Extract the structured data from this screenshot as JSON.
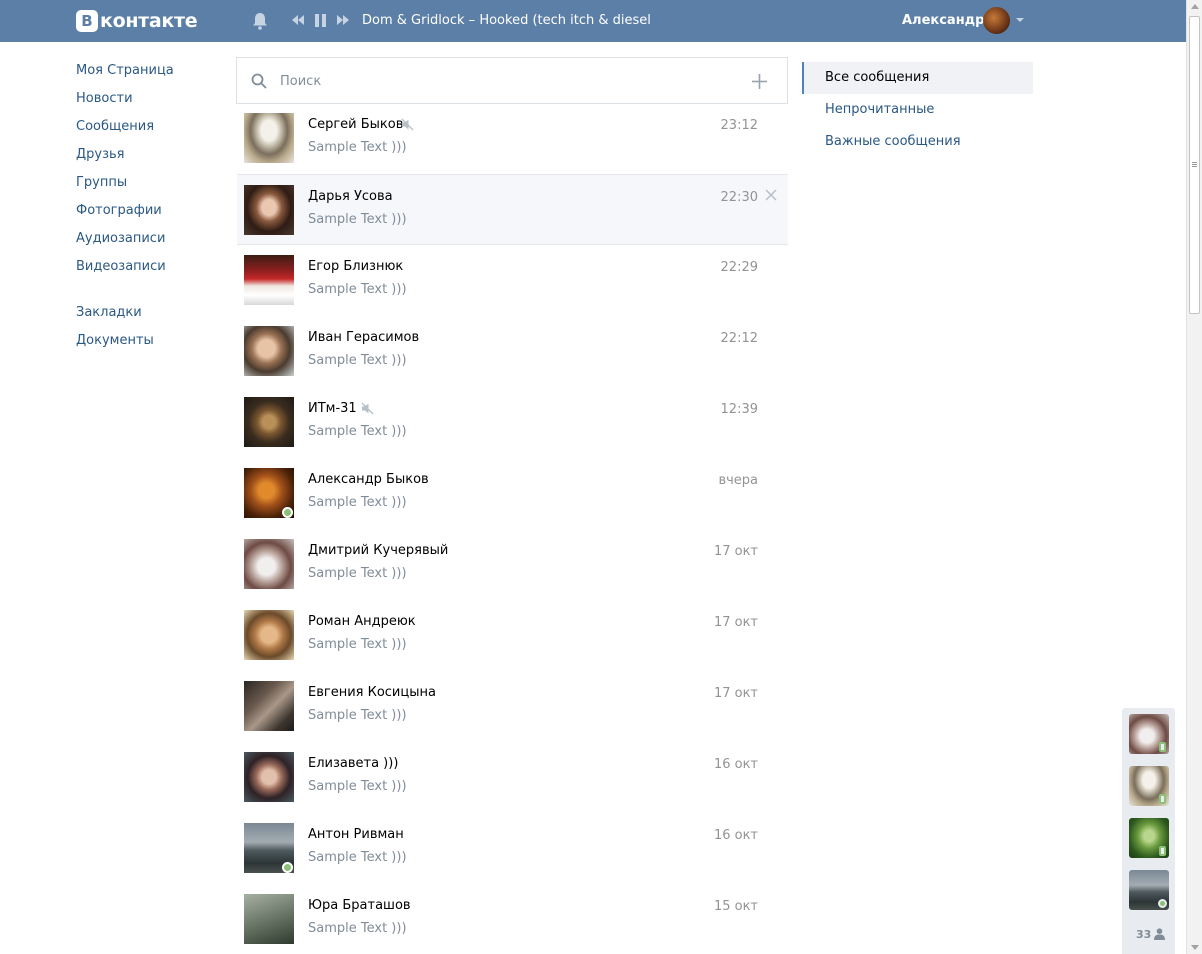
{
  "header": {
    "logo_letter": "В",
    "logo_text": "контакте",
    "track": "Dom & Gridlock – Hooked (tech itch & dieselbo...",
    "user_name": "Александр",
    "bg_color": "#5b7fa6"
  },
  "left_nav": {
    "items": [
      {
        "label": "Моя Страница"
      },
      {
        "label": "Новости"
      },
      {
        "label": "Сообщения"
      },
      {
        "label": "Друзья"
      },
      {
        "label": "Группы"
      },
      {
        "label": "Фотографии"
      },
      {
        "label": "Аудиозаписи"
      },
      {
        "label": "Видеозаписи"
      }
    ],
    "extra_items": [
      {
        "label": "Закладки"
      },
      {
        "label": "Документы"
      }
    ]
  },
  "search": {
    "placeholder": "Поиск"
  },
  "dialogs": [
    {
      "name": "Сергей Быков",
      "text": "Sample Text )))",
      "time": "23:12",
      "muted": true,
      "online": false,
      "avatar": "cosplay"
    },
    {
      "name": "Дарья Усова",
      "text": "Sample Text )))",
      "time": "22:30",
      "muted": false,
      "online": false,
      "avatar": "girl-dark",
      "hover": true
    },
    {
      "name": "Егор Близнюк",
      "text": "Sample Text )))",
      "time": "22:29",
      "muted": false,
      "online": false,
      "avatar": "hockey"
    },
    {
      "name": "Иван Герасимов",
      "text": "Sample Text )))",
      "time": "22:12",
      "muted": false,
      "online": false,
      "avatar": "boy"
    },
    {
      "name": "ИТм-31",
      "text": "Sample Text )))",
      "time": "12:39",
      "muted": true,
      "online": false,
      "avatar": "cat"
    },
    {
      "name": "Александр Быков",
      "text": "Sample Text )))",
      "time": "вчера",
      "muted": false,
      "online": true,
      "avatar": "orange"
    },
    {
      "name": "Дмитрий Кучерявый",
      "text": "Sample Text )))",
      "time": "17 окт",
      "muted": false,
      "online": false,
      "avatar": "smoke"
    },
    {
      "name": "Роман Андреюк",
      "text": "Sample Text )))",
      "time": "17 окт",
      "muted": false,
      "online": false,
      "avatar": "couple"
    },
    {
      "name": "Евгения Косицына",
      "text": "Sample Text )))",
      "time": "17 окт",
      "muted": false,
      "online": false,
      "avatar": "group"
    },
    {
      "name": "Елизавета )))",
      "text": "Sample Text )))",
      "time": "16 окт",
      "muted": false,
      "online": false,
      "avatar": "girl2"
    },
    {
      "name": "Антон Ривман",
      "text": "Sample Text )))",
      "time": "16 окт",
      "muted": false,
      "online": true,
      "avatar": "lake"
    },
    {
      "name": "Юра Браташов",
      "text": "Sample Text )))",
      "time": "15 окт",
      "muted": false,
      "online": false,
      "avatar": "fog"
    }
  ],
  "right_menu": {
    "items": [
      {
        "label": "Все сообщения",
        "active": true
      },
      {
        "label": "Непрочитанные",
        "active": false
      },
      {
        "label": "Важные сообщения",
        "active": false
      }
    ]
  },
  "chat_dock": {
    "count": "33",
    "items": [
      {
        "avatar": "smoke",
        "status": "mobile"
      },
      {
        "avatar": "cosplay",
        "status": "mobile"
      },
      {
        "avatar": "forest",
        "status": "mobile"
      },
      {
        "avatar": "lake",
        "status": "online"
      }
    ]
  },
  "colors": {
    "link": "#2a5885",
    "muted_text": "#818c99",
    "online": "#8ac176"
  }
}
